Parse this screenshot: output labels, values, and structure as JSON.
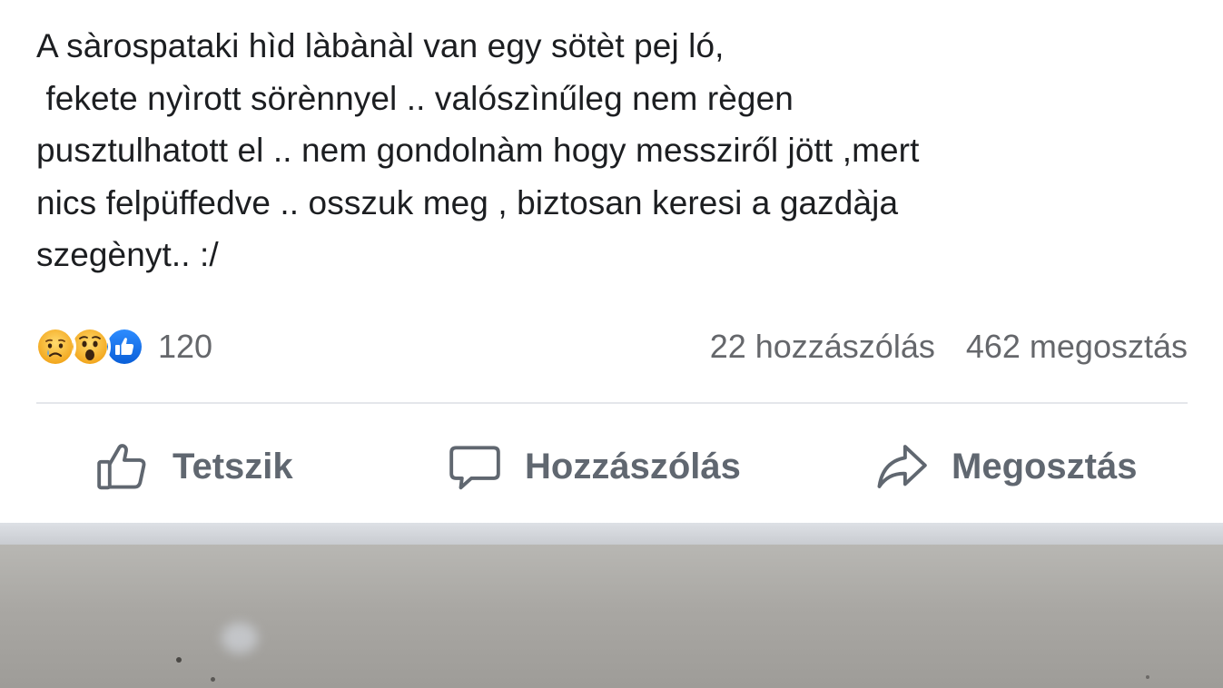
{
  "post": {
    "text_lines": [
      "A sàrospataki hìd làbànàl van egy sötèt pej ló,",
      " fekete nyìrott sörènnyel .. valószìnűleg nem règen",
      "pusztulhatott el .. nem gondolnàm hogy messziről jött ,mert",
      "nics felpüffedve .. osszuk meg , biztosan keresi a gazdàja",
      "szegènyt.. :/"
    ]
  },
  "stats": {
    "reaction_icons": [
      "sad-reaction-icon",
      "wow-reaction-icon",
      "like-reaction-icon"
    ],
    "reaction_count": "120",
    "comments": "22 hozzászólás",
    "shares": "462 megosztás"
  },
  "actions": {
    "like_label": "Tetszik",
    "comment_label": "Hozzászólás",
    "share_label": "Megosztás",
    "like_icon": "thumbs-up-icon",
    "comment_icon": "comment-bubble-icon",
    "share_icon": "share-arrow-icon"
  },
  "colors": {
    "text": "#1c1e21",
    "secondary_text": "#65676b",
    "action_text": "#606770",
    "like_blue": "#1877f2",
    "reaction_yellow": "#f7b125",
    "divider": "#e4e6eb",
    "photo_gray": "#a9a7a3"
  }
}
